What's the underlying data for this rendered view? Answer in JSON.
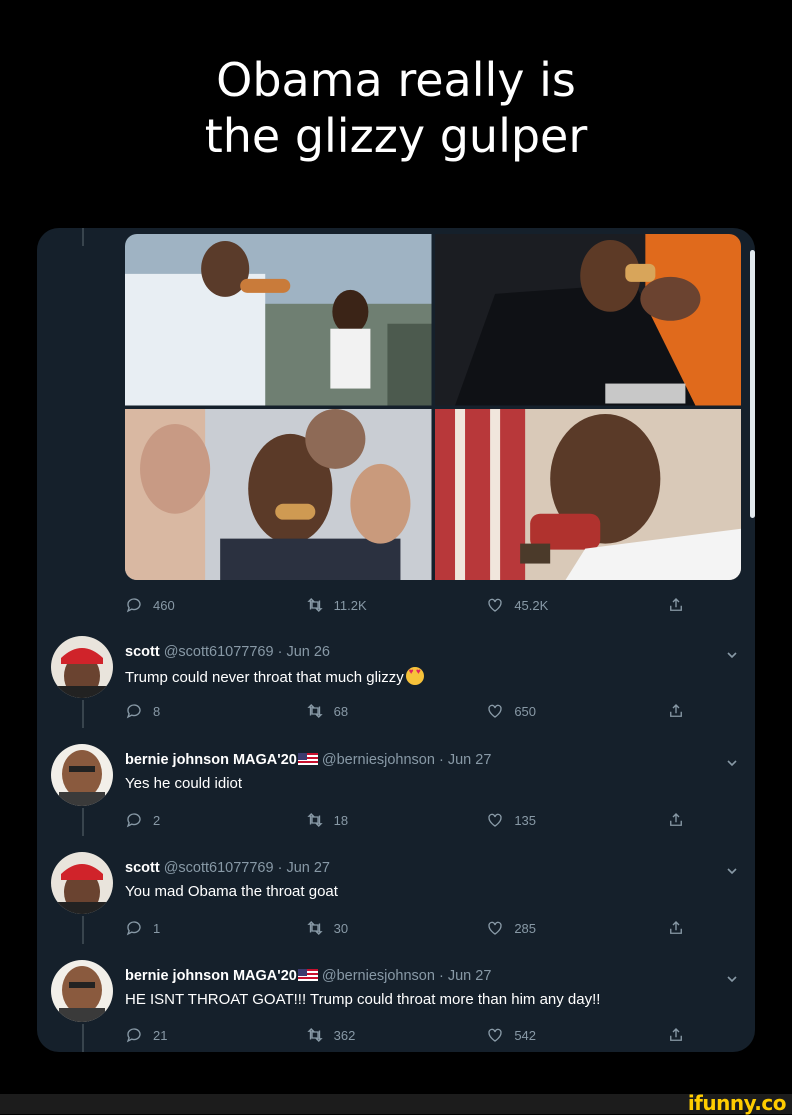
{
  "meme": {
    "caption_line1": "Obama really is",
    "caption_line2": "the glizzy gulper"
  },
  "colors": {
    "background": "#000000",
    "card": "#15202b",
    "muted": "#8899a6",
    "divider": "#38444d",
    "brand": "#ffcc00"
  },
  "main_tweet": {
    "photos": [
      "photo-eating-hotdog-outdoors",
      "photo-eating-hotdog-dark-jacket",
      "photo-eating-hotdog-crowd",
      "photo-eating-sandwich-open-mouth"
    ],
    "replies": "460",
    "retweets": "11.2K",
    "likes": "45.2K"
  },
  "replies": [
    {
      "name": "scott",
      "handle": "@scott61077769",
      "date": "Jun 26",
      "text": "Trump could never throat that much glizzy",
      "replies": "8",
      "retweets": "68",
      "likes": "650"
    },
    {
      "name": "bernie johnson MAGA'20",
      "handle": "@berniesjohnson",
      "date": "Jun 27",
      "text": "Yes he could idiot",
      "replies": "2",
      "retweets": "18",
      "likes": "135"
    },
    {
      "name": "scott",
      "handle": "@scott61077769",
      "date": "Jun 27",
      "text": "You mad Obama the throat goat",
      "replies": "1",
      "retweets": "30",
      "likes": "285"
    },
    {
      "name": "bernie johnson MAGA'20",
      "handle": "@berniesjohnson",
      "date": "Jun 27",
      "text": "HE ISNT THROAT GOAT!!! Trump could throat more than him any day!!",
      "replies": "21",
      "retweets": "362",
      "likes": "542"
    }
  ],
  "separator": "·",
  "watermark": {
    "text": "ifunny.co"
  }
}
